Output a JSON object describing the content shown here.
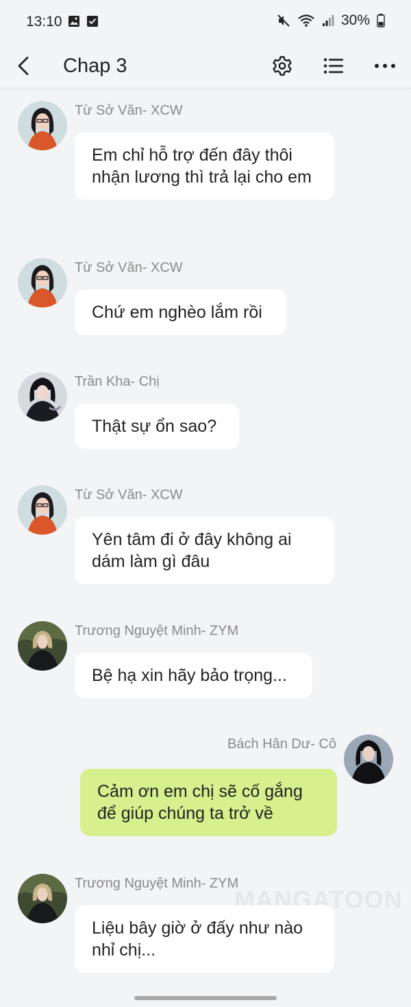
{
  "status_bar": {
    "time": "13:10",
    "battery": "30%",
    "icons": [
      "gallery-icon",
      "checkbox-icon",
      "mute-icon",
      "wifi-icon",
      "signal-icon",
      "battery-icon"
    ]
  },
  "header": {
    "title": "Chap 3",
    "icons": [
      "back-icon",
      "gear-icon",
      "list-icon",
      "more-icon"
    ]
  },
  "messages": [
    {
      "sender": "Từ Sở Văn- XCW",
      "text": "Em chỉ hỗ trợ đến đây thôi nhận lương thì trả lại cho em",
      "direction": "incoming"
    },
    {
      "sender": "Từ Sở Văn- XCW",
      "text": "Chứ em nghèo lắm rồi",
      "direction": "incoming"
    },
    {
      "sender": "Trần Kha- Chị",
      "text": "Thật sự ổn sao?",
      "direction": "incoming"
    },
    {
      "sender": "Từ Sở Văn- XCW",
      "text": "Yên tâm đi ở đây không ai dám làm gì đâu",
      "direction": "incoming"
    },
    {
      "sender": "Trương Nguyệt Minh- ZYM",
      "text": "Bệ hạ xin hãy bảo trọng...",
      "direction": "incoming"
    },
    {
      "sender": "Bách Hân Dư- Cô",
      "text": "Cảm ơn em chị sẽ cố gắng để giúp chúng ta trở về",
      "direction": "outgoing"
    },
    {
      "sender": "Trương Nguyệt Minh- ZYM",
      "text": "Liệu bây giờ ở đấy như nào nhỉ chị...",
      "direction": "incoming"
    }
  ],
  "watermark": "MANGATOON",
  "colors": {
    "background": "#f3f4f6",
    "incoming_bubble": "#ffffff",
    "outgoing_bubble": "#d6f08e",
    "sender_name": "#8a8a8a"
  }
}
